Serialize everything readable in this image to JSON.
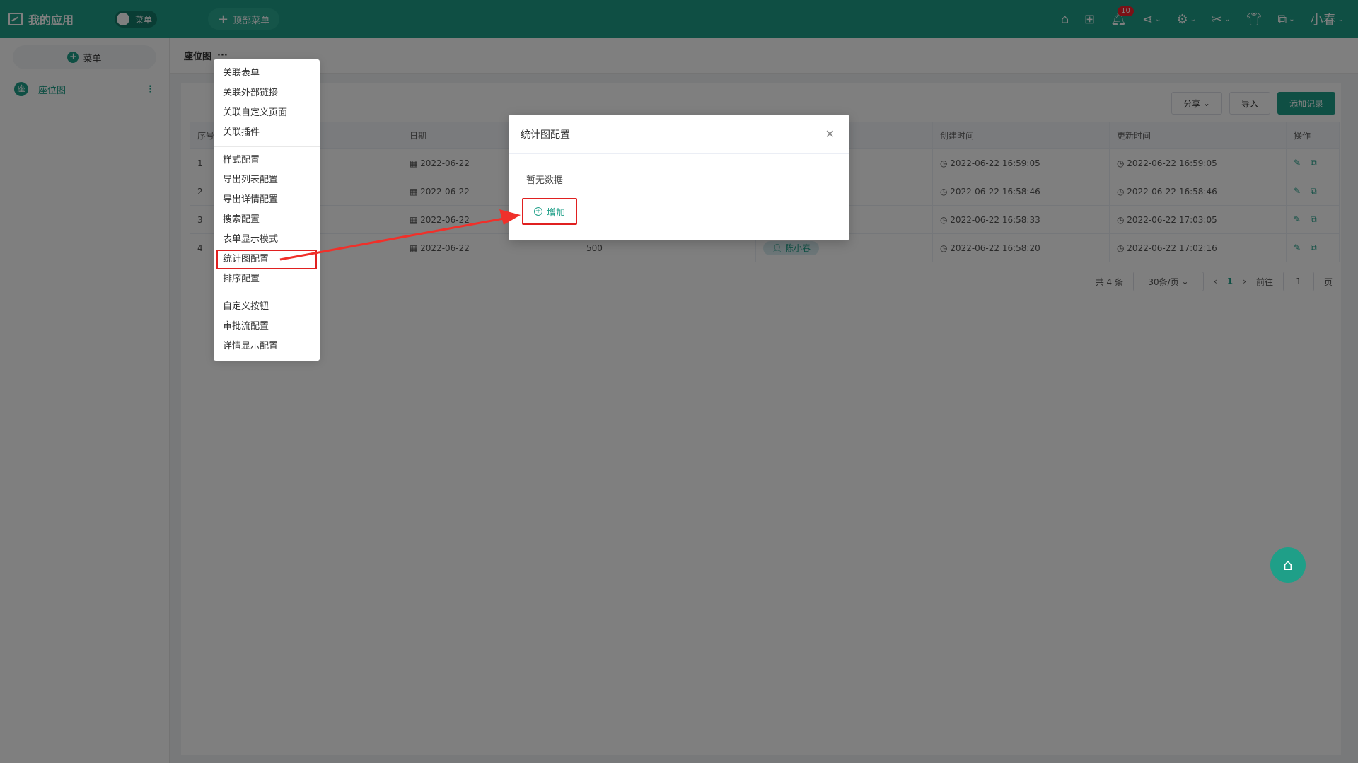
{
  "topbar": {
    "app_title": "我的应用",
    "menu_toggle": "菜单",
    "top_menu": "顶部菜单",
    "notif_count": "10",
    "user": "小春"
  },
  "sidebar": {
    "add_menu": "菜单",
    "items": [
      {
        "label": "座位图",
        "icon": "座"
      }
    ]
  },
  "crumb": {
    "title": "座位图",
    "more": "···"
  },
  "toolbar": {
    "share": "分享",
    "import": "导入",
    "add_record": "添加记录"
  },
  "table": {
    "headers": [
      "序号",
      "",
      "日期",
      "",
      "",
      "创建时间",
      "更新时间",
      "操作"
    ],
    "rows": [
      {
        "idx": "1",
        "date": "2022-06-22",
        "value": "",
        "person": "",
        "created": "2022-06-22 16:59:05",
        "updated": "2022-06-22 16:59:05"
      },
      {
        "idx": "2",
        "date": "2022-06-22",
        "value": "",
        "person": "",
        "created": "2022-06-22 16:58:46",
        "updated": "2022-06-22 16:58:46"
      },
      {
        "idx": "3",
        "date": "2022-06-22",
        "value": "",
        "person": "",
        "created": "2022-06-22 16:58:33",
        "updated": "2022-06-22 17:03:05"
      },
      {
        "idx": "4",
        "date": "2022-06-22",
        "value": "500",
        "person": "陈小春",
        "created": "2022-06-22 16:58:20",
        "updated": "2022-06-22 17:02:16"
      }
    ]
  },
  "pager": {
    "total": "共 4 条",
    "page_size": "30条/页",
    "current": "1",
    "goto": "前往",
    "goto_value": "1",
    "page_unit": "页"
  },
  "dropdown": {
    "group1": [
      "关联表单",
      "关联外部链接",
      "关联自定义页面",
      "关联插件"
    ],
    "group2": [
      "样式配置",
      "导出列表配置",
      "导出详情配置",
      "搜索配置",
      "表单显示模式",
      "统计图配置",
      "排序配置"
    ],
    "group3": [
      "自定义按钮",
      "审批流配置",
      "详情显示配置"
    ]
  },
  "dialog": {
    "title": "统计图配置",
    "empty": "暂无数据",
    "add": "增加"
  },
  "colors": {
    "brand": "#1f9f88",
    "highlight": "#e02020"
  }
}
